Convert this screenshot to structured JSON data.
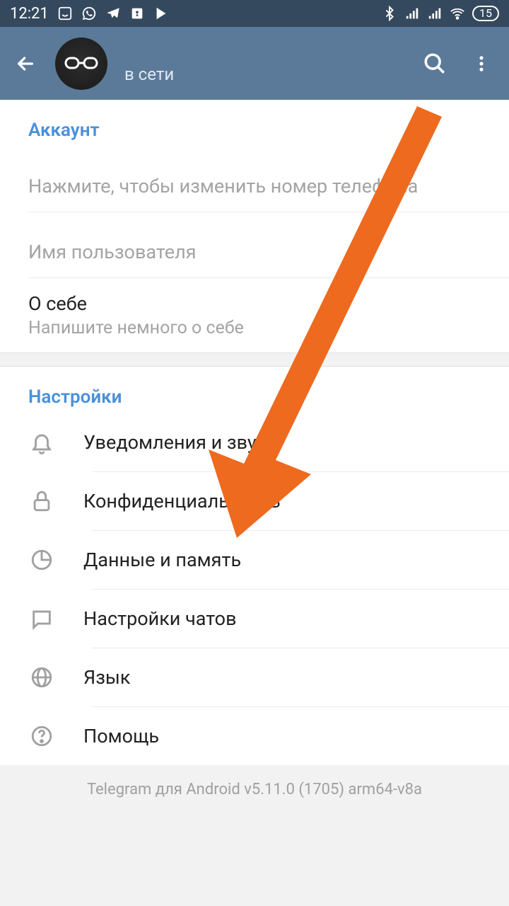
{
  "status_bar": {
    "time": "12:21",
    "battery": "15"
  },
  "header": {
    "status": "в сети"
  },
  "account": {
    "section_title": "Аккаунт",
    "phone_hint": "Нажмите, чтобы изменить номер телефона",
    "username_label": "Имя пользователя",
    "bio_label": "О себе",
    "bio_hint": "Напишите немного о себе"
  },
  "settings": {
    "section_title": "Настройки",
    "items": [
      {
        "label": "Уведомления и звук",
        "icon": "bell"
      },
      {
        "label": "Конфиденциальность",
        "icon": "lock"
      },
      {
        "label": "Данные и память",
        "icon": "pie"
      },
      {
        "label": "Настройки чатов",
        "icon": "chat"
      },
      {
        "label": "Язык",
        "icon": "globe"
      },
      {
        "label": "Помощь",
        "icon": "help"
      }
    ]
  },
  "footer": {
    "version": "Telegram для Android v5.11.0 (1705) arm64-v8a"
  }
}
